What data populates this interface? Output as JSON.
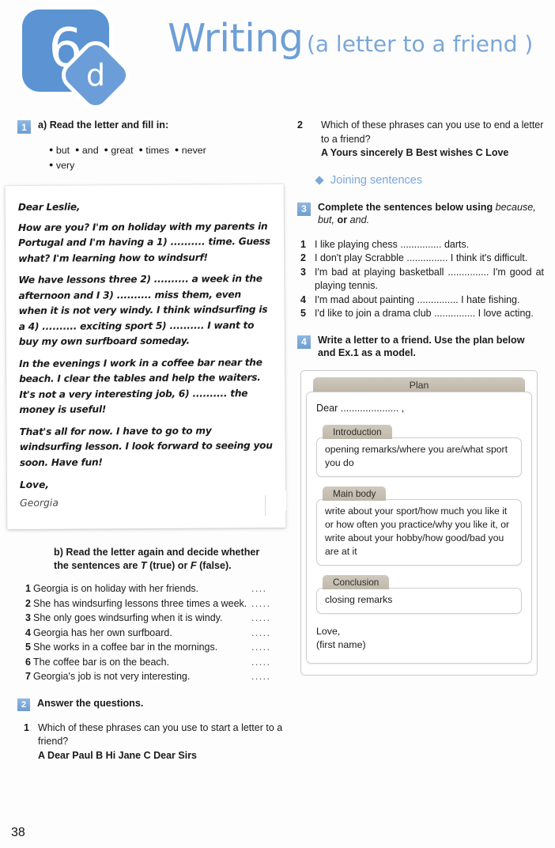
{
  "header": {
    "unit_number": "6",
    "unit_letter": "d",
    "title_main": "Writing",
    "title_sub": "(a letter to a friend )"
  },
  "page_number": "38",
  "left": {
    "ex1": {
      "number": "1",
      "instruction_a": "a) Read the letter and fill in:",
      "words": [
        "but",
        "and",
        "great",
        "times",
        "never",
        "very"
      ],
      "letter": {
        "greeting": "Dear Leslie,",
        "paragraphs": [
          "How are you? I'm on holiday with my parents in Portugal and I'm having a 1) .......... time. Guess what? I'm learning how to windsurf!",
          "We have lessons three 2) .......... a week in the afternoon and I 3) .......... miss them, even when it is not very windy. I think windsurfing is a 4) .......... exciting sport 5) .......... I want to buy my own surfboard someday.",
          "In the evenings I work in a coffee bar near the beach. I clear the tables and help the waiters. It's not a very interesting job, 6) .......... the money is useful!",
          "That's all for now. I have to go to my windsurfing lesson. I look forward to seeing you soon. Have fun!"
        ],
        "signoff": "Love,",
        "name": "Georgia"
      },
      "instruction_b_1": "b) Read the letter again and decide whether the sentences are ",
      "instruction_b_t": "T",
      "instruction_b_2": " (true) or ",
      "instruction_b_f": "F",
      "instruction_b_3": " (false).",
      "tf_items": [
        {
          "n": "1",
          "text": "Georgia is on holiday with her friends.",
          "dots": "...."
        },
        {
          "n": "2",
          "text": "She has windsurfing lessons three times a week.",
          "dots": "....."
        },
        {
          "n": "3",
          "text": "She only goes windsurfing when it is windy.",
          "dots": "....."
        },
        {
          "n": "4",
          "text": "Georgia has her own surfboard.",
          "dots": "....."
        },
        {
          "n": "5",
          "text": "She works in a coffee bar in the mornings.",
          "dots": "....."
        },
        {
          "n": "6",
          "text": "The coffee bar is on the beach.",
          "dots": "....."
        },
        {
          "n": "7",
          "text": "Georgia's job is not very interesting.",
          "dots": "....."
        }
      ]
    },
    "ex2": {
      "number": "2",
      "instruction": "Answer the questions.",
      "q1": {
        "n": "1",
        "text": "Which of these phrases can you use to start a letter to a friend?",
        "options": "A Dear Paul     B Hi Jane   C Dear Sirs"
      }
    }
  },
  "right": {
    "ex2_q2": {
      "n": "2",
      "text": "Which of these phrases can you use to end a letter to a friend?",
      "options": "A Yours sincerely  B Best wishes   C Love"
    },
    "section_title": "Joining sentences",
    "ex3": {
      "number": "3",
      "instruction_plain": "Complete the sentences below using ",
      "instruction_italic": "because, but,",
      "instruction_plain2": " or ",
      "instruction_italic2": "and.",
      "items": [
        {
          "n": "1",
          "text": "I like playing chess ............... darts."
        },
        {
          "n": "2",
          "text": "I don't play Scrabble ............... I think it's difficult."
        },
        {
          "n": "3",
          "text": "I'm bad at playing basketball ............... I'm good at playing tennis."
        },
        {
          "n": "4",
          "text": "I'm mad about painting ............... I hate fishing."
        },
        {
          "n": "5",
          "text": "I'd like to join a drama club ............... I love acting."
        }
      ]
    },
    "ex4": {
      "number": "4",
      "instruction": "Write a letter to a friend. Use the plan below and Ex.1 as a model.",
      "plan": {
        "tab_title": "Plan",
        "dear_line": "Dear ..................... ,",
        "sections": [
          {
            "label": "Introduction",
            "body": "opening remarks/where you are/what sport you do"
          },
          {
            "label": "Main body",
            "body": "write about your sport/how much you like it or how often you practice/why you like it, or write about your hobby/how good/bad you are at it"
          },
          {
            "label": "Conclusion",
            "body": "closing remarks"
          }
        ],
        "closing_line1": "Love,",
        "closing_line2": "(first name)"
      }
    }
  },
  "colors": {
    "accent_blue": "#6e9fd6",
    "badge_blue": "#5b93d3",
    "plan_tan": "#c0b8aa"
  }
}
